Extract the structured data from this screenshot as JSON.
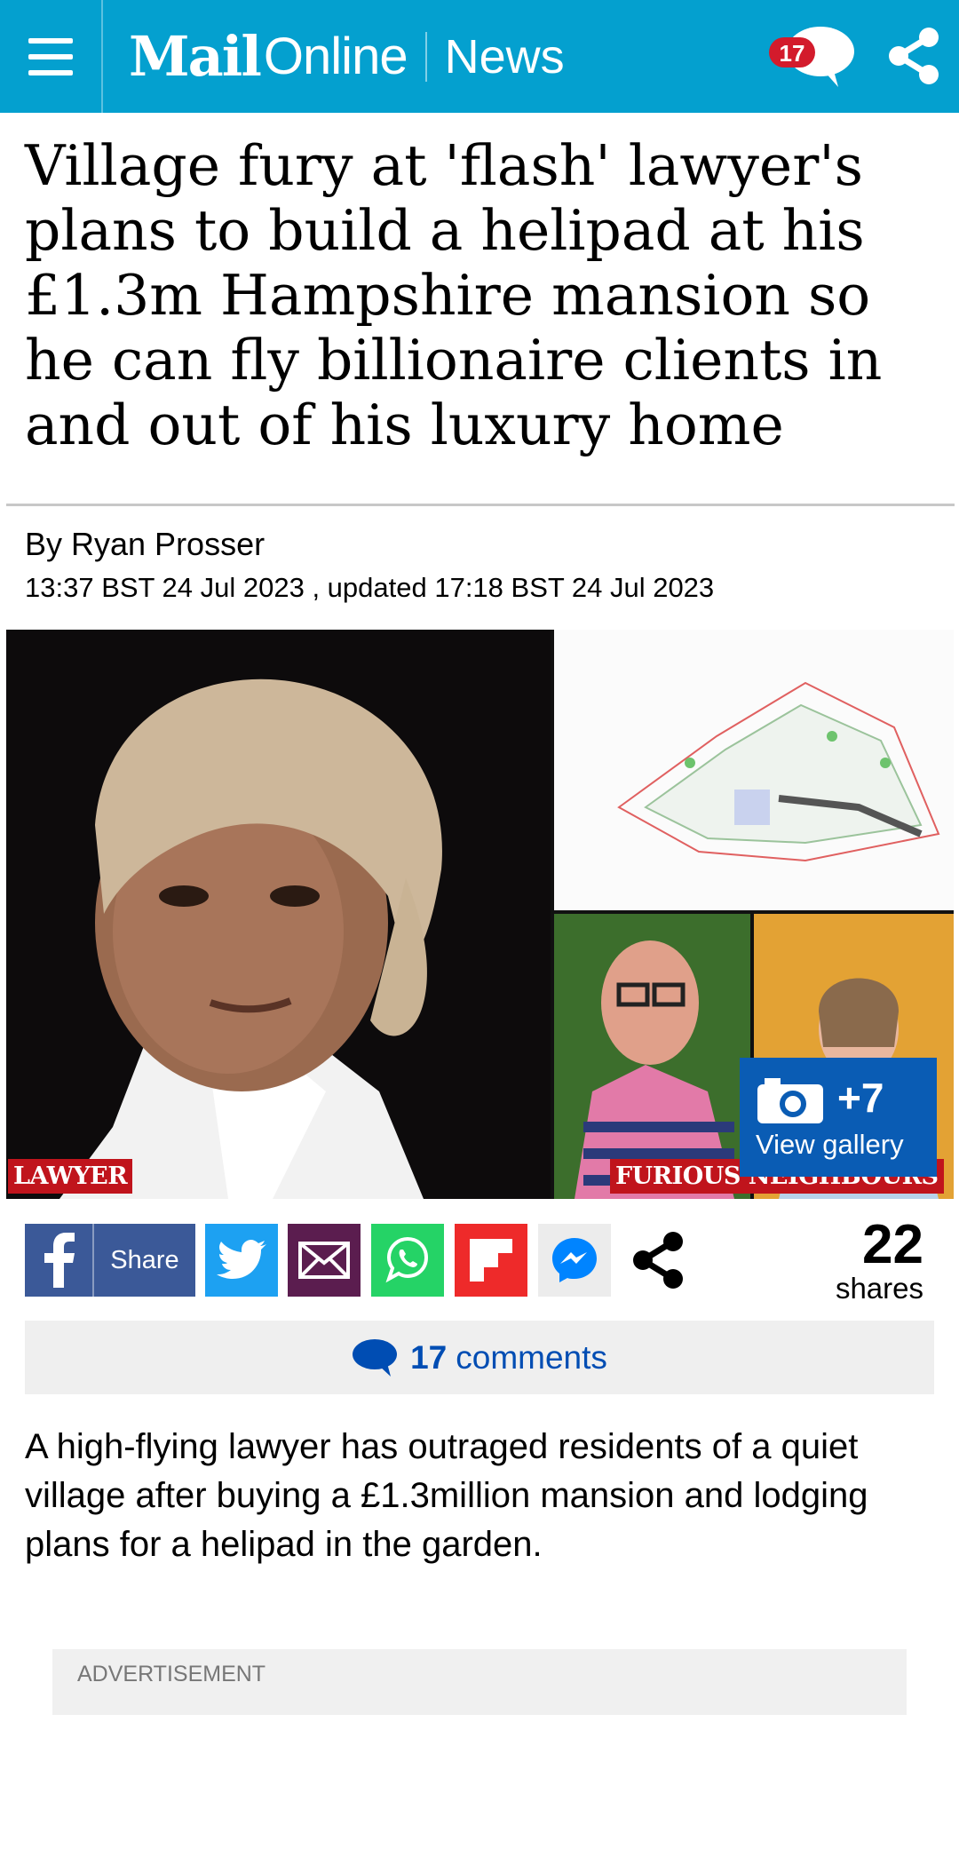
{
  "header": {
    "logo_mail": "Mail",
    "logo_online": "Online",
    "section": "News",
    "comment_count": "17",
    "colors": {
      "bar": "#04a0cf",
      "badge": "#d31b2c"
    }
  },
  "article": {
    "headline": "Village fury at 'flash' lawyer's plans to build a helipad at his £1.3m Hampshire mansion so he can fly billionaire clients in and out of his luxury home",
    "byline_prefix": "By ",
    "author": "Ryan Prosser",
    "dates": "13:37 BST 24 Jul 2023 , updated 17:18 BST 24 Jul 2023",
    "lead": "A high-flying lawyer has outraged residents of a quiet village after buying a £1.3million mansion and lodging plans for a helipad in the garden."
  },
  "hero": {
    "tag_left": "LAWYER",
    "tag_right": "FURIOUS NEIGHBOURS",
    "gallery_count": "+7",
    "gallery_label": "View gallery"
  },
  "share": {
    "facebook_label": "Share",
    "count": "22",
    "count_label": "shares"
  },
  "comments": {
    "count": "17",
    "label": "comments"
  },
  "ad": {
    "label": "ADVERTISEMENT"
  }
}
